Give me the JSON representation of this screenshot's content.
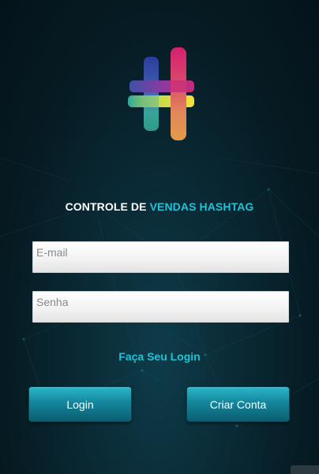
{
  "header": {
    "title_part1": "CONTROLE DE ",
    "title_part2": "VENDAS HASHTAG"
  },
  "form": {
    "email_placeholder": "E-mail",
    "password_placeholder": "Senha",
    "login_link": "Faça Seu Login"
  },
  "buttons": {
    "login": "Login",
    "create_account": "Criar Conta"
  },
  "colors": {
    "accent": "#1fc2d6",
    "background": "#061a22",
    "button": "#14869c"
  },
  "icons": {
    "logo": "hashtag-logo-icon"
  }
}
